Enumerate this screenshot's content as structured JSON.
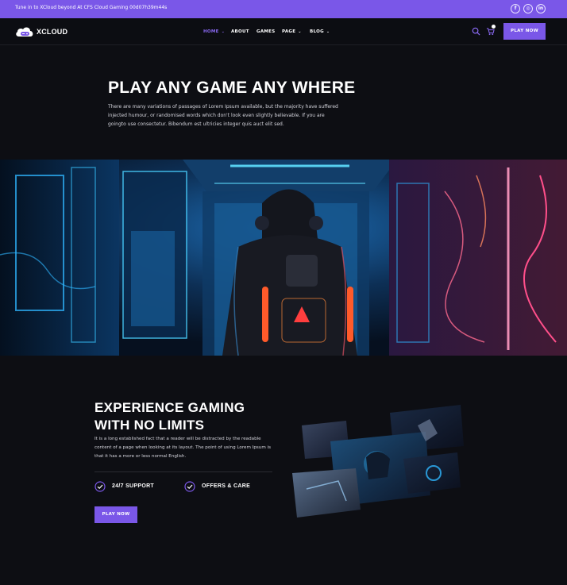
{
  "topbar": {
    "announcement": "Tune in to XCloud beyond At CFS Cloud Gaming 00d07h39m44s",
    "social": [
      {
        "icon": "facebook-icon",
        "glyph": "f"
      },
      {
        "icon": "instagram-icon",
        "glyph": "◎"
      },
      {
        "icon": "linkedin-icon",
        "glyph": "in"
      }
    ]
  },
  "header": {
    "logo_text": "XCLOUD",
    "nav": [
      {
        "label": "HOME",
        "dropdown": true,
        "active": true
      },
      {
        "label": "ABOUT",
        "dropdown": false
      },
      {
        "label": "GAMES",
        "dropdown": false
      },
      {
        "label": "PAGE",
        "dropdown": true
      },
      {
        "label": "BLOG",
        "dropdown": true
      }
    ],
    "cta_label": "PLAY NOW"
  },
  "hero": {
    "title": "PLAY ANY GAME ANY WHERE",
    "text": "There are many variations of passages of Lorem Ipsum available, but the majority have suffered injected humour, or randomised words which don't look even slightly believable. If you are goingto use consectetur. Bibendum est ultricies integer quis auct elit sed."
  },
  "experience": {
    "title_line1": "EXPERIENCE GAMING",
    "title_line2": "WITH NO LIMITS",
    "text": "It is a long established fact that a reader will be distracted by the readable content of a page when looking at its layout. The point of using Lorem Ipsum is that it has a more or less normal English.",
    "features": [
      "24/7 SUPPORT",
      "OFFERS & CARE"
    ],
    "cta_label": "PLAY NOW"
  },
  "colors": {
    "accent": "#7a57e8",
    "background": "#0d0e13",
    "neon_blue": "#2fb6ff",
    "neon_pink": "#ff4f8a"
  }
}
